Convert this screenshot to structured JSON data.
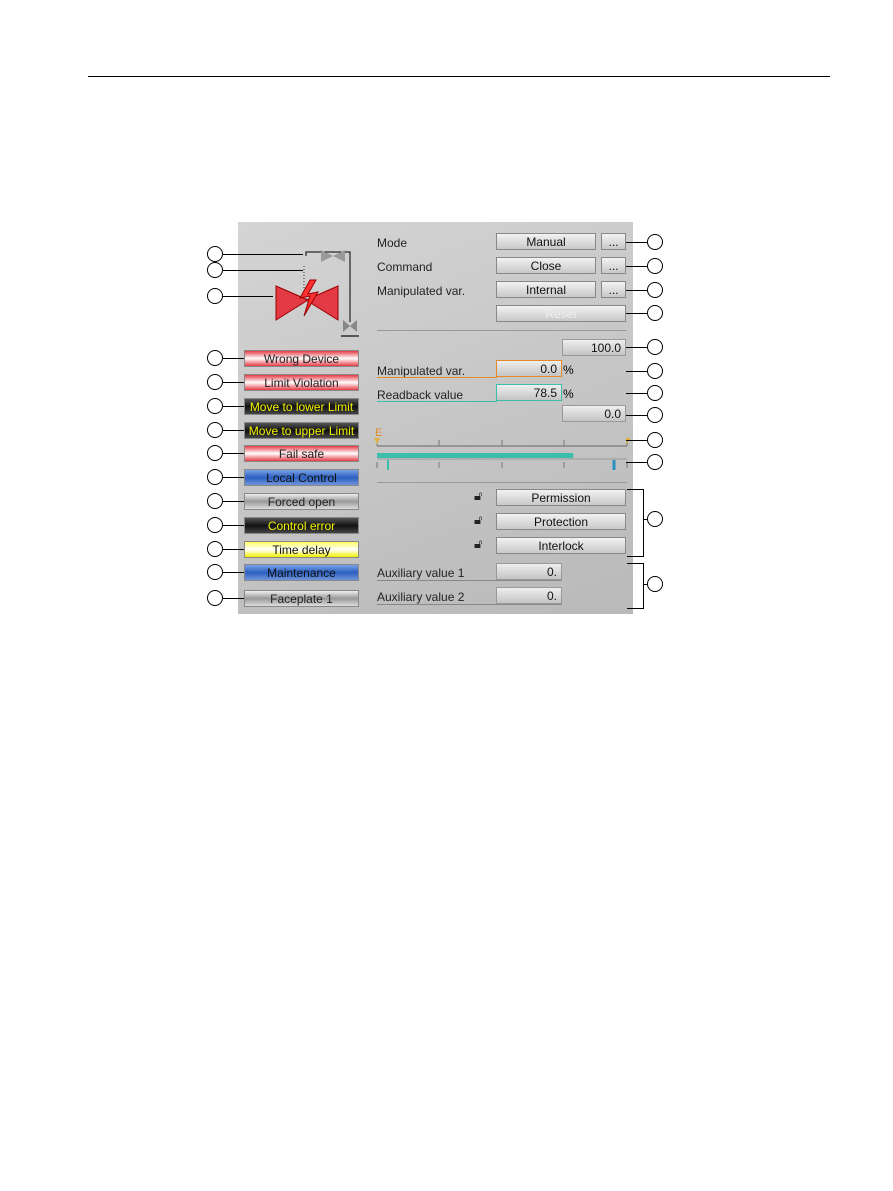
{
  "status_buttons": [
    "Wrong Device",
    "Limit Violation",
    "Move to lower Limit",
    "Move to upper Limit",
    "Fail safe",
    "Local Control",
    "Forced open",
    "Control error",
    "Time delay",
    "Maintenance",
    "Faceplate 1"
  ],
  "rows": {
    "mode": {
      "label": "Mode",
      "value": "Manual",
      "more": "..."
    },
    "command": {
      "label": "Command",
      "value": "Close",
      "more": "..."
    },
    "manip": {
      "label": "Manipulated var.",
      "value": "Internal",
      "more": "..."
    },
    "reset": "Reset"
  },
  "values": {
    "high": "100.0",
    "low": "0.0",
    "manip_label": "Manipulated var.",
    "manip_value": "0.0",
    "readback_label": "Readback value",
    "readback_value": "78.5",
    "unit": "%"
  },
  "bar": {
    "marker": "E",
    "readback_percent": 78.5,
    "manip_percent": 0
  },
  "interlocks": [
    "Permission",
    "Protection",
    "Interlock"
  ],
  "aux": [
    {
      "label": "Auxiliary value 1",
      "value": "0."
    },
    {
      "label": "Auxiliary value 2",
      "value": "0."
    }
  ],
  "colors": {
    "orange": "#e08a2a",
    "teal": "#3cbfaa",
    "red": "#e43a45",
    "blue": "#2c5fc0"
  }
}
